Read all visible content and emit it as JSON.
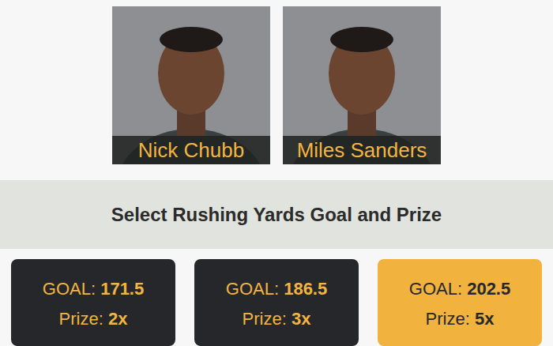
{
  "players": [
    {
      "name": "Nick Chubb"
    },
    {
      "name": "Miles Sanders"
    }
  ],
  "title": "Select Rushing Yards Goal and Prize",
  "options": [
    {
      "goal_label": "GOAL:",
      "goal": "171.5",
      "prize_label": "Prize:",
      "prize": "2x",
      "selected": false
    },
    {
      "goal_label": "GOAL:",
      "goal": "186.5",
      "prize_label": "Prize:",
      "prize": "3x",
      "selected": false
    },
    {
      "goal_label": "GOAL:",
      "goal": "202.5",
      "prize_label": "Prize:",
      "prize": "5x",
      "selected": true
    }
  ]
}
